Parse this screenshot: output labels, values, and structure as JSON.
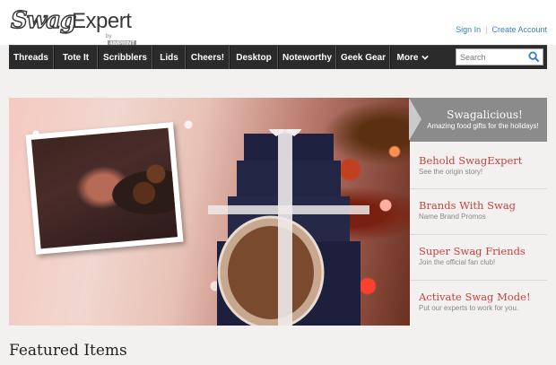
{
  "brand": {
    "logo_script": "Swag",
    "logo_word": "Expert",
    "logo_by": "by",
    "logo_by_brand": "4IMPRINT"
  },
  "account": {
    "sign_in": "Sign In",
    "create_account": "Create Account"
  },
  "nav": {
    "items": [
      "Threads",
      "Tote It",
      "Scribblers",
      "Lids",
      "Cheers!",
      "Desktop",
      "Noteworthy",
      "Geek Gear"
    ],
    "more_label": "More",
    "search_placeholder": "Search"
  },
  "hero": {
    "tag_title": "Swagalicious!",
    "tag_subtitle": "Amazing food gifts for the holidays!"
  },
  "side_links": [
    {
      "title": "Behold SwagExpert",
      "subtitle": "See the origin story!"
    },
    {
      "title": "Brands With Swag",
      "subtitle": "Name Brand Promos"
    },
    {
      "title": "Super Swag Friends",
      "subtitle": "Join the official fan club!"
    },
    {
      "title": "Activate Swag Mode!",
      "subtitle": "Put our experts to work for you."
    }
  ],
  "featured": {
    "heading": "Featured Items"
  },
  "colors": {
    "nav_bg": "#2b2b2b",
    "link_blue": "#3a7fc2",
    "accent_red": "#c9423a",
    "tag_gray": "#8b8b8b"
  }
}
